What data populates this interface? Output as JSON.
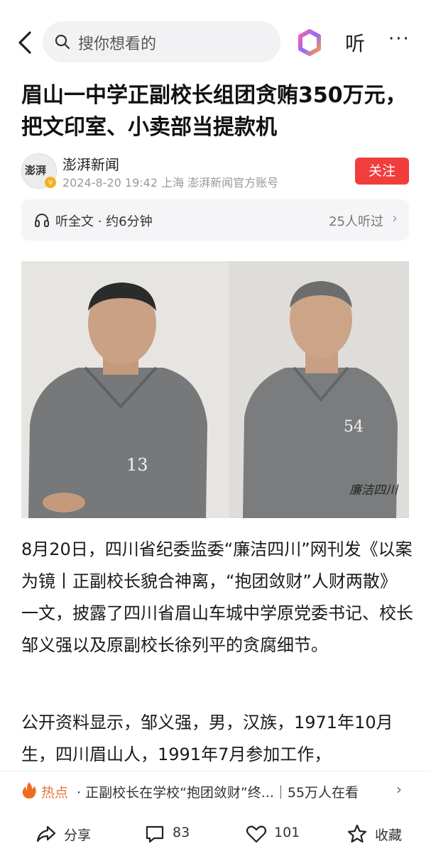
{
  "header": {
    "search_placeholder": "搜你想看的",
    "listen_label": "听",
    "more_label": "···"
  },
  "article": {
    "title": "眉山一中学正副校长组团贪贿350万元，把文印室、小卖部当提款机",
    "author": {
      "name": "澎湃新闻",
      "avatar_text": "澎湃",
      "meta": "2024-8-20  19:42  上海  澎湃新闻官方账号",
      "follow_label": "关注"
    },
    "audio": {
      "label": "听全文 · 约6分钟",
      "listeners": "25人听过"
    },
    "image": {
      "left_number": "13",
      "right_number": "54",
      "watermark": "廉洁四川"
    },
    "paragraphs": [
      "8月20日，四川省纪委监委“廉洁四川”网刊发《以案为镜丨正副校长貌合神离，“抱团敛财”人财两散》一文，披露了四川省眉山车城中学原党委书记、校长邹义强以及原副校长徐列平的贪腐细节。",
      "公开资料显示，邹义强，男，汉族，1971年10月生，四川眉山人，1991年7月参加工作，"
    ]
  },
  "hot": {
    "label": "热点",
    "text": "· 正副校长在学校“抱团敛财”终...｜55万人在看"
  },
  "actions": {
    "share": "分享",
    "comments": "83",
    "likes": "101",
    "favorite": "收藏"
  },
  "colors": {
    "follow": "#f23d3d",
    "hot": "#e6783a"
  }
}
